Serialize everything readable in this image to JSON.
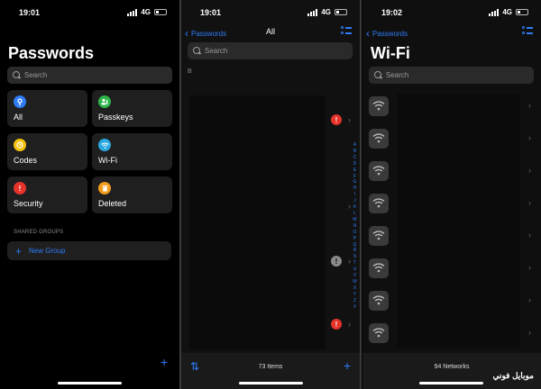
{
  "panel1": {
    "status": {
      "time": "19:01",
      "network": "4G"
    },
    "title": "Passwords",
    "search_placeholder": "Search",
    "tiles": [
      {
        "label": "All",
        "icon": "key-icon",
        "color": "#2f7cf6"
      },
      {
        "label": "Passkeys",
        "icon": "person-badge-icon",
        "color": "#2fb54a"
      },
      {
        "label": "Codes",
        "icon": "clock-icon",
        "color": "#f3c20c"
      },
      {
        "label": "Wi-Fi",
        "icon": "wifi-icon",
        "color": "#2aa8e0"
      },
      {
        "label": "Security",
        "icon": "exclamation-icon",
        "color": "#e5332a"
      },
      {
        "label": "Deleted",
        "icon": "trash-icon",
        "color": "#f29a1b"
      }
    ],
    "shared_groups_header": "SHARED GROUPS",
    "new_group_label": "New Group",
    "add_icon": "+"
  },
  "panel2": {
    "status": {
      "time": "19:01",
      "network": "4G"
    },
    "back_label": "Passwords",
    "title": "All",
    "search_placeholder": "Search",
    "section_letter": "B",
    "index_letters": [
      "A",
      "B",
      "C",
      "D",
      "E",
      "F",
      "G",
      "H",
      "I",
      "J",
      "K",
      "L",
      "M",
      "N",
      "O",
      "P",
      "Q",
      "R",
      "S",
      "T",
      "U",
      "V",
      "W",
      "X",
      "Y",
      "Z",
      "#"
    ],
    "item_count": "73 Items",
    "add_icon": "+"
  },
  "panel3": {
    "status": {
      "time": "19:02",
      "network": "4G"
    },
    "back_label": "Passwords",
    "title": "Wi-Fi",
    "search_placeholder": "Search",
    "network_count": "94 Networks"
  },
  "watermark": "موبايل فوني"
}
